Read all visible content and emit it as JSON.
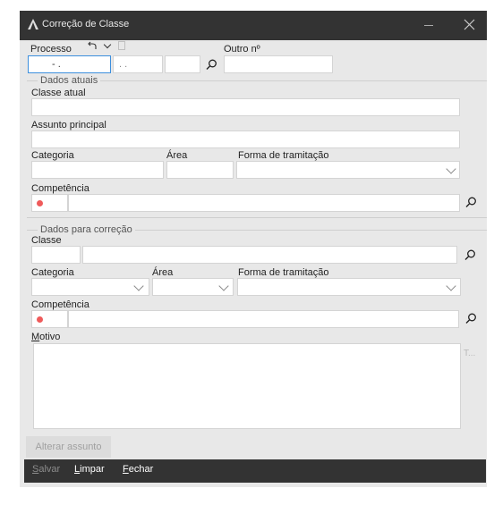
{
  "window": {
    "title": "Correção de Classe"
  },
  "header": {
    "processo_label": "Processo",
    "outro_label": "Outro nº",
    "processo_mask_1": "-     .",
    "processo_mask_2": ".   ."
  },
  "dados_atuais": {
    "group_label": "Dados atuais",
    "classe_label": "Classe atual",
    "assunto_label": "Assunto principal",
    "categoria_label": "Categoria",
    "area_label": "Área",
    "forma_label": "Forma de tramitação",
    "competencia_label": "Competência"
  },
  "dados_correcao": {
    "group_label": "Dados para correção",
    "classe_label": "Classe",
    "categoria_label": "Categoria",
    "area_label": "Área",
    "forma_label": "Forma de tramitação",
    "competencia_label": "Competência",
    "motivo_label_first": "M",
    "motivo_label_rest": "otivo",
    "motivo_side": "T..."
  },
  "actions": {
    "alterar_label": "Alterar assunto",
    "salvar_first": "S",
    "salvar_rest": "alvar",
    "limpar_first": "L",
    "limpar_rest": "impar",
    "fechar_first": "F",
    "fechar_rest": "echar"
  },
  "colors": {
    "titlebar": "#333333",
    "panel": "#e8e8e8",
    "required_dot": "#ef5a5a"
  }
}
